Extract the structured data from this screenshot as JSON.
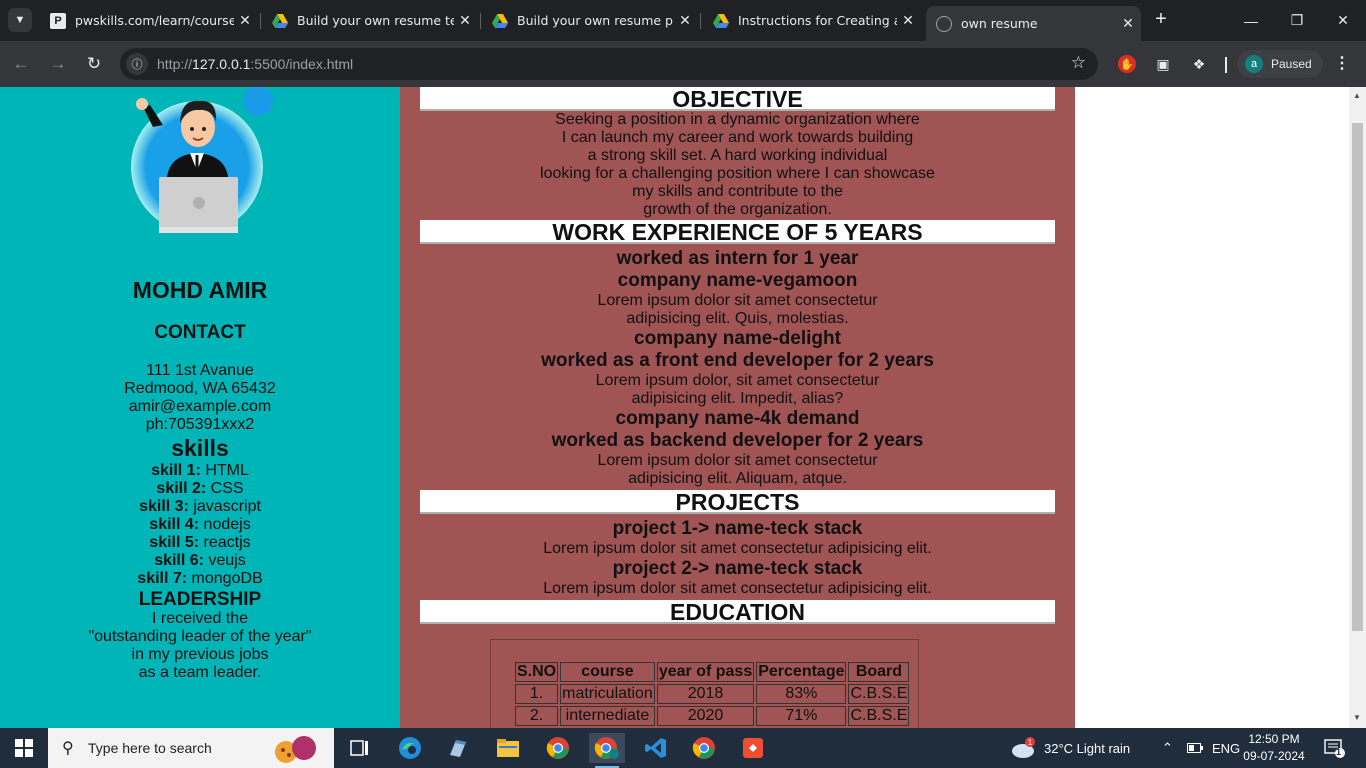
{
  "browser": {
    "tabs": [
      {
        "title": "pwskills.com/learn/course/fu",
        "icon": "pwskills-icon"
      },
      {
        "title": "Build your own resume temp",
        "icon": "google-drive-icon"
      },
      {
        "title": "Build your own resume proje",
        "icon": "google-drive-icon"
      },
      {
        "title": "Instructions for Creating and",
        "icon": "google-drive-icon"
      },
      {
        "title": "own resume",
        "icon": "globe-icon",
        "active": true
      }
    ],
    "new_tab": "+",
    "url_host": "http://",
    "url_domain": "127.0.0.1",
    "url_rest": ":5500/index.html",
    "profile_initial": "a",
    "profile_status": "Paused"
  },
  "sidebar": {
    "name": "MOHD AMIR",
    "contact_heading": "CONTACT",
    "address": [
      "111 1st Avanue",
      "Redmood, WA 65432",
      "amir@example.com",
      "ph:705391xxx2"
    ],
    "skills_heading": "skills",
    "skills": [
      {
        "label": "skill 1:",
        "value": " HTML"
      },
      {
        "label": "skill 2:",
        "value": " CSS"
      },
      {
        "label": "skill 3:",
        "value": " javascript"
      },
      {
        "label": "skill 4:",
        "value": " nodejs"
      },
      {
        "label": "skill 5:",
        "value": " reactjs"
      },
      {
        "label": "skill 6:",
        "value": " veujs"
      },
      {
        "label": "skill 7:",
        "value": " mongoDB"
      }
    ],
    "leadership_heading": "LEADERSHIP",
    "leadership": [
      "I received the",
      "\"outstanding leader of the year\"",
      "in my previous jobs",
      "as a team leader."
    ]
  },
  "main": {
    "objective_heading": "OBJECTIVE",
    "objective": [
      "Seeking a position in a dynamic organization where",
      "I can launch my career and work towards building",
      "a strong skill set. A hard working individual",
      "looking for a challenging position where I can showcase",
      "my skills and contribute to the",
      "growth of the organization."
    ],
    "work_heading": "WORK EXPERIENCE OF 5 YEARS",
    "work": {
      "intern": "worked as intern for 1 year",
      "company1": "company name-vegamoon",
      "desc1": [
        "Lorem ipsum dolor sit amet consectetur",
        "adipisicing elit. Quis, molestias."
      ],
      "company2": "company name-delight",
      "role2": "worked as a front end developer for 2 years",
      "desc2": [
        "Lorem ipsum dolor, sit amet consectetur",
        "adipisicing elit. Impedit, alias?"
      ],
      "company3": "company name-4k demand",
      "role3": "worked as backend developer for 2 years",
      "desc3": [
        "Lorem ipsum dolor sit amet consectetur",
        "adipisicing elit. Aliquam, atque."
      ]
    },
    "projects_heading": "PROJECTS",
    "projects": [
      {
        "title": "project 1-> name-teck stack",
        "desc": "Lorem ipsum dolor sit amet consectetur adipisicing elit."
      },
      {
        "title": "project 2-> name-teck stack",
        "desc": "Lorem ipsum dolor sit amet consectetur adipisicing elit."
      }
    ],
    "education_heading": "EDUCATION",
    "education_table": {
      "headers": [
        "S.NO",
        "course",
        "year of pass",
        "Percentage",
        "Board"
      ],
      "rows": [
        [
          "1.",
          "matriculation",
          "2018",
          "83%",
          "C.B.S.E"
        ],
        [
          "2.",
          "internediate",
          "2020",
          "71%",
          "C.B.S.E"
        ]
      ]
    }
  },
  "taskbar": {
    "search_placeholder": "Type here to search",
    "weather": "32°C  Light rain",
    "language": "ENG",
    "time": "12:50 PM",
    "date": "09-07-2024",
    "notification_count": "1",
    "weather_badge": "1"
  },
  "colors": {
    "sidebar_bg": "#00b5b8",
    "main_bg": "#a05454",
    "taskbar_bg": "#1f2d3d"
  }
}
